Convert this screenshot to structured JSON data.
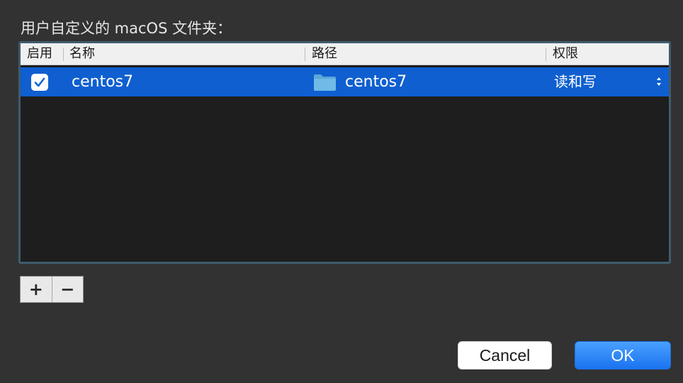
{
  "section_title": "用户自定义的 macOS 文件夹：",
  "table": {
    "columns": {
      "enabled": "启用",
      "name": "名称",
      "path": "路径",
      "permission": "权限"
    },
    "rows": [
      {
        "enabled": true,
        "name": "centos7",
        "path": "centos7",
        "permission": "读和写",
        "selected": true
      }
    ]
  },
  "controls": {
    "add_label": "+",
    "remove_label": "−"
  },
  "buttons": {
    "cancel_label": "Cancel",
    "ok_label": "OK"
  },
  "colors": {
    "selection": "#0f5fd0",
    "accent": "#1a73f0",
    "background": "#323232"
  },
  "icons": {
    "checkbox": "checkmark-icon",
    "path": "folder-icon",
    "permission": "up-down-stepper-icon"
  }
}
